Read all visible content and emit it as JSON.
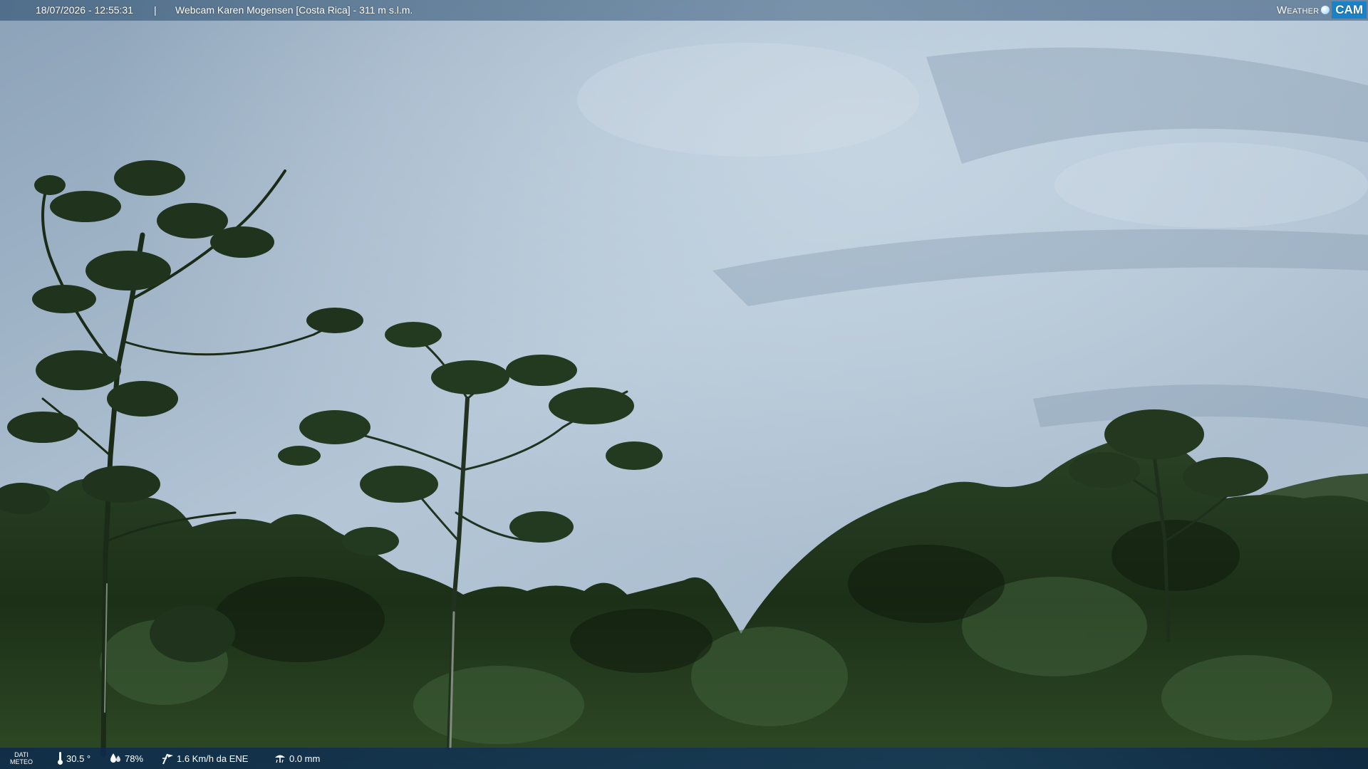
{
  "overlay": {
    "datetime": "18/07/2026 - 12:55:31",
    "separator": "|",
    "location": "Webcam Karen Mogensen [Costa Rica]  - 311 m s.l.m."
  },
  "brand": {
    "weather": "Weather",
    "cam": "CAM"
  },
  "weather_data": {
    "label_line1": "DATI",
    "label_line2": "METEO",
    "temperature": "30.5 °",
    "humidity": "78%",
    "wind": "1.6 Km/h da ENE",
    "rain": "0.0 mm"
  },
  "icons": {
    "temperature": "thermometer-icon",
    "humidity": "humidity-drops-icon",
    "wind": "wind-vane-icon",
    "rain": "rain-gauge-icon",
    "brand_dot": "weathercam-dot-icon"
  },
  "colors": {
    "sky_top": "#8aa0b6",
    "sky_mid": "#b6c7d6",
    "foliage_dark": "#13220f",
    "foliage_mid": "#2a3f22",
    "brand_accent": "#1a82c8",
    "bottom_bar": "#0e3262"
  }
}
